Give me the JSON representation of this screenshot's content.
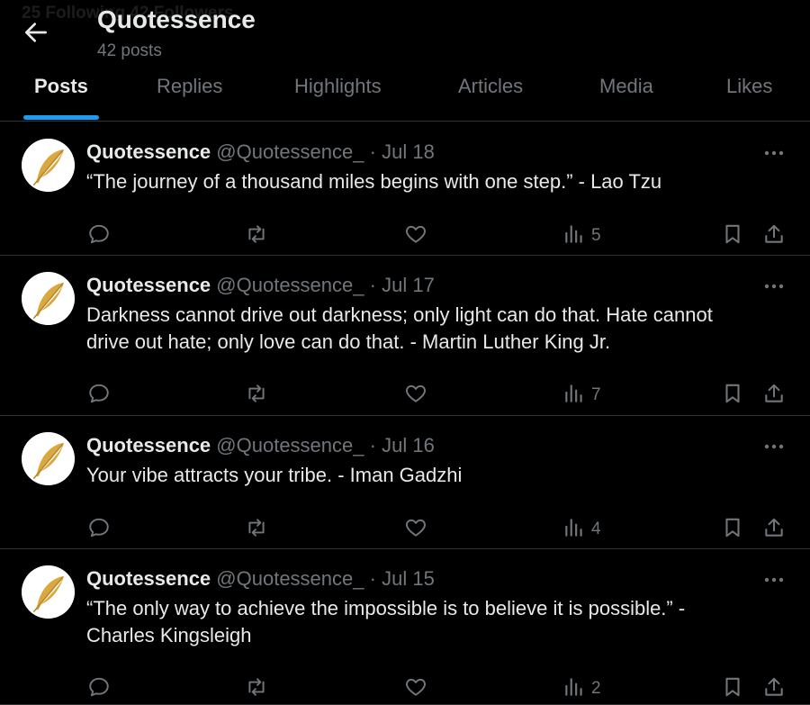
{
  "header": {
    "ghost_text": "25 Following  42 Followers",
    "title": "Quotessence",
    "post_count": "42 posts"
  },
  "tabs": [
    {
      "label": "Posts",
      "active": true
    },
    {
      "label": "Replies",
      "active": false
    },
    {
      "label": "Highlights",
      "active": false
    },
    {
      "label": "Articles",
      "active": false
    },
    {
      "label": "Media",
      "active": false
    },
    {
      "label": "Likes",
      "active": false
    }
  ],
  "colors": {
    "accent": "#1d9bf0",
    "text_primary": "#e7e9ea",
    "text_secondary": "#71767b",
    "avatar_feather": "#d9a93f"
  },
  "icons": {
    "back": "arrow-left-icon",
    "more": "more-horizontal-icon",
    "reply": "reply-icon",
    "repost": "repost-icon",
    "like": "heart-icon",
    "views": "bar-chart-icon",
    "bookmark": "bookmark-icon",
    "share": "share-icon"
  },
  "posts": [
    {
      "name": "Quotessence",
      "handle": "@Quotessence_",
      "separator": "·",
      "date": "Jul 18",
      "lines": [
        "“The journey of a thousand miles begins with one step.” - Lao Tzu"
      ],
      "views": "5"
    },
    {
      "name": "Quotessence",
      "handle": "@Quotessence_",
      "separator": "·",
      "date": "Jul 17",
      "lines": [
        "Darkness cannot drive out darkness; only light can do that. Hate cannot",
        "drive out hate; only love can do that. - Martin Luther King Jr."
      ],
      "views": "7"
    },
    {
      "name": "Quotessence",
      "handle": "@Quotessence_",
      "separator": "·",
      "date": "Jul 16",
      "lines": [
        "Your vibe attracts your tribe. - Iman Gadzhi"
      ],
      "views": "4"
    },
    {
      "name": "Quotessence",
      "handle": "@Quotessence_",
      "separator": "·",
      "date": "Jul 15",
      "lines": [
        "“The only way to achieve the impossible is to believe it is possible.” -",
        "Charles Kingsleigh"
      ],
      "views": "2"
    }
  ]
}
